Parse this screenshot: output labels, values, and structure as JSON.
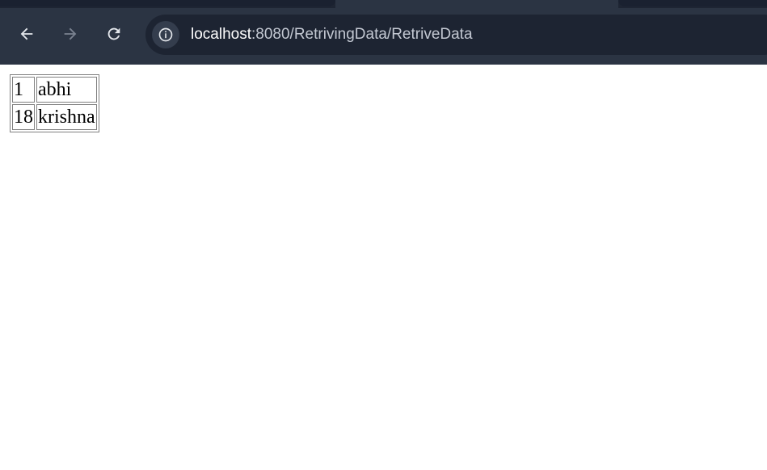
{
  "browser": {
    "url_host": "localhost",
    "url_rest": ":8080/RetrivingData/RetriveData",
    "icons": {
      "back": "back-arrow-icon",
      "forward": "forward-arrow-icon",
      "reload": "reload-icon",
      "site_info": "info-icon"
    },
    "colors": {
      "toolbar": "#2b3443",
      "omnibox": "#1d2432"
    }
  },
  "table": {
    "rows": [
      {
        "id": "1",
        "name": "abhi"
      },
      {
        "id": "18",
        "name": "krishna"
      }
    ]
  }
}
